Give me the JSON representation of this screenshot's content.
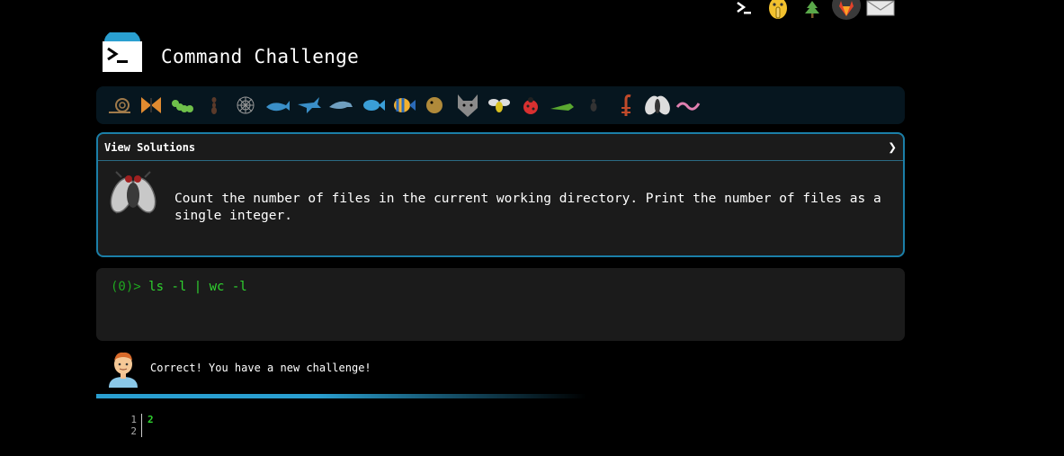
{
  "header": {
    "title": "Command Challenge"
  },
  "top_icons": [
    "terminal-icon",
    "shush-face-icon",
    "tree-icon",
    "gitlab-icon",
    "mail-icon"
  ],
  "animals": [
    "snail",
    "butterfly",
    "caterpillar",
    "ant",
    "spider-web",
    "whale",
    "shark",
    "dolphin",
    "fish",
    "tropical-fish",
    "blowfish",
    "wolf",
    "bee",
    "ladybug",
    "cricket",
    "spider",
    "scorpion",
    "fly",
    "worm"
  ],
  "challenge": {
    "view_solutions": "View Solutions",
    "chevron": "❯",
    "task": "Count the number of files in the current working directory. Print the number of files as a single integer."
  },
  "terminal": {
    "prompt_num": "(0)>",
    "command": "ls -l | wc -l"
  },
  "feedback": {
    "message": "Correct! You have a new challenge!"
  },
  "output": {
    "lines": [
      {
        "num": "1",
        "text": "2"
      },
      {
        "num": "2",
        "text": ""
      }
    ]
  },
  "colors": {
    "accent": "#2a9fd0",
    "prompt_green": "#2fd32f",
    "card_border": "#1b7fa8"
  }
}
